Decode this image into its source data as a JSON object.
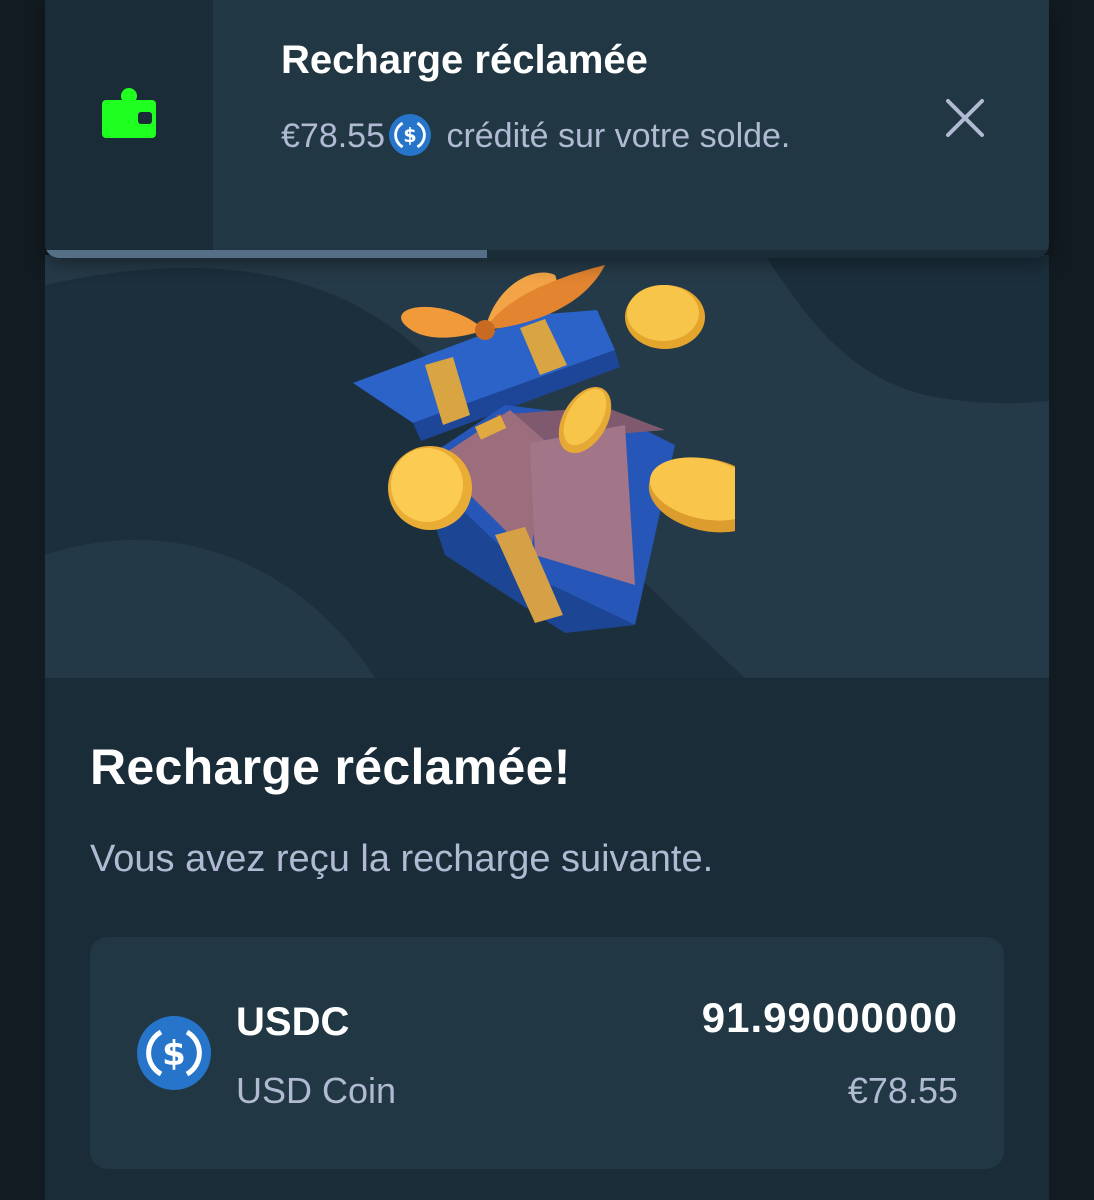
{
  "toast": {
    "title": "Recharge réclamée",
    "amount": "€78.55",
    "message_suffix": "crédité sur votre solde.",
    "close_icon": "close-icon",
    "wallet_icon": "wallet-icon",
    "wallet_color": "#1fff20",
    "progress": 0.44
  },
  "modal": {
    "title": "Recharge réclamée!",
    "subtitle": "Vous avez reçu la recharge suivante.",
    "hero_icon": "gift-box-with-coins",
    "asset": {
      "symbol": "USDC",
      "name": "USD Coin",
      "amount": "91.99000000",
      "fiat_value": "€78.55",
      "icon": "usdc-icon",
      "icon_color": "#2775ca"
    }
  }
}
